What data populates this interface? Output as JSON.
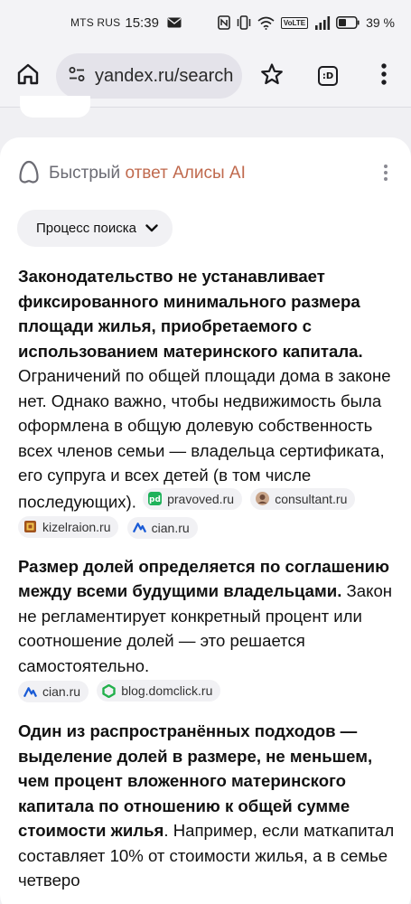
{
  "status_bar": {
    "carrier": "MTS RUS",
    "time": "15:39",
    "volte": "VoLTE",
    "battery_percent": "39 %"
  },
  "browser": {
    "url": "yandex.ru/search",
    "tab_count": ":D"
  },
  "alice": {
    "title_prefix": "Быстрый ",
    "title_accent": "ответ Алисы AI",
    "process_label": "Процесс поиска"
  },
  "answer": {
    "p1_bold": "Законодательство не устанавливает фиксированного минимального размера площади жилья, приобретаемого с использованием материнского капитала.",
    "p1_text": " Ограничений по общей площади дома в законе нет. Однако важно, чтобы недвижимость была оформлена в общую долевую собственность всех членов семьи — владельца сертификата, его супруга и всех детей (в том числе последующих).",
    "p1_sources": [
      "pravoved.ru",
      "consultant.ru",
      "kizelraion.ru",
      "cian.ru"
    ],
    "p2_bold": "Размер долей определяется по соглашению между всеми будущими владельцами.",
    "p2_text": " Закон не регламентирует конкретный процент или соотношение долей — это решается самостоятельно.",
    "p2_sources": [
      "cian.ru",
      "blog.domclick.ru"
    ],
    "p3_bold": "Один из распространённых подходов — выделение долей в размере, не меньшем, чем процент вложенного материнского капитала по отношению к общей сумме стоимости жилья",
    "p3_text": ". Например, если маткапитал составляет 10% от стоимости жилья, а в семье четверо"
  },
  "icons": {
    "home": "home-icon",
    "site_settings": "tune-icon",
    "bookmark": "star-icon",
    "menu": "more-vert-icon",
    "alice": "alice-logo-icon"
  },
  "colors": {
    "accent": "#c06a4e",
    "card": "#ffffff",
    "chip": "#f1f1f4"
  }
}
